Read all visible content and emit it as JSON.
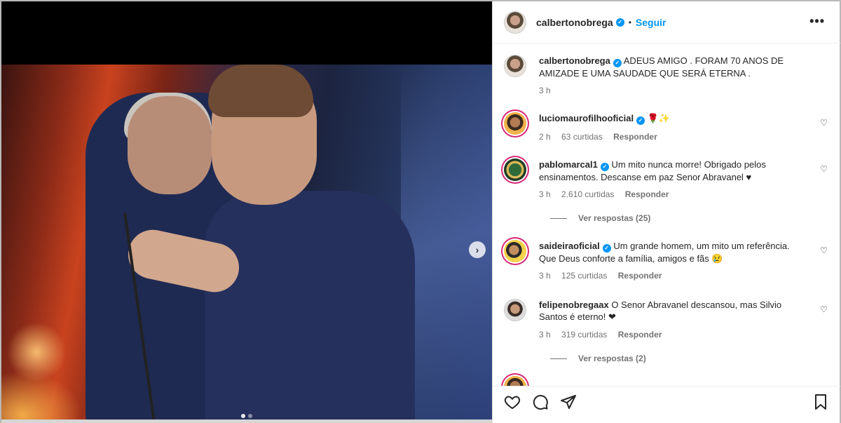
{
  "post": {
    "author": "calbertonobrega",
    "separator": "•",
    "follow_label": "Seguir",
    "more_label": "•••",
    "caption": "ADEUS AMIGO . FORAM 70 ANOS DE AMIZADE E UMA SAUDADE QUE SERÁ ETERNA .",
    "caption_time": "3 h"
  },
  "comments": [
    {
      "username": "luciomaurofilhooficial",
      "text": "🌹✨",
      "time": "2 h",
      "likes": "63 curtidas",
      "reply": "Responder"
    },
    {
      "username": "pablomarcal1",
      "text": "Um mito nunca morre! Obrigado pelos ensinamentos. Descanse em paz Senor Abravanel ♥",
      "time": "3 h",
      "likes": "2.610 curtidas",
      "reply": "Responder",
      "view_replies": "Ver respostas (25)"
    },
    {
      "username": "saideiraoficial",
      "text": "Um grande homem, um mito um referência. Que Deus conforte a família, amigos e fãs 😢",
      "time": "3 h",
      "likes": "125 curtidas",
      "reply": "Responder"
    },
    {
      "username": "felipenobregaax",
      "text": "O Senor Abravanel descansou, mas Silvio Santos é eterno! ❤",
      "time": "3 h",
      "likes": "319 curtidas",
      "reply": "Responder",
      "view_replies": "Ver respostas (2)"
    }
  ],
  "colors": {
    "accent": "#0095f6",
    "muted": "#737373",
    "text": "#262626"
  },
  "icons": {
    "next": "chevron-right-icon",
    "like": "heart-icon",
    "comment": "comment-icon",
    "share": "share-icon",
    "save": "bookmark-icon"
  }
}
